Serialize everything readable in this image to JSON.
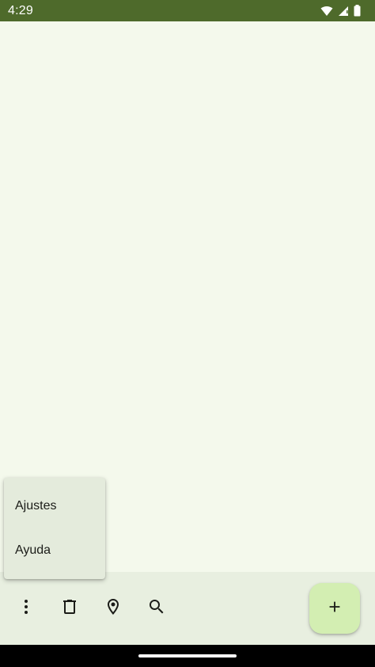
{
  "status_bar": {
    "time": "4:29",
    "icons": [
      "wifi-icon",
      "cellular-signal-icon",
      "battery-icon"
    ]
  },
  "overflow_menu": {
    "items": [
      {
        "label": "Ajustes"
      },
      {
        "label": "Ayuda"
      }
    ]
  },
  "bottom_app_bar": {
    "actions": [
      "more-vert-icon",
      "delete-icon",
      "location-pin-icon",
      "search-icon"
    ],
    "fab_icon": "add-icon"
  },
  "colors": {
    "status_bar": "#4e6a2b",
    "background": "#f4f9ec",
    "menu_surface": "#e4ebdc",
    "bottom_bar": "#e8efe0",
    "fab": "#d3eeb2"
  }
}
